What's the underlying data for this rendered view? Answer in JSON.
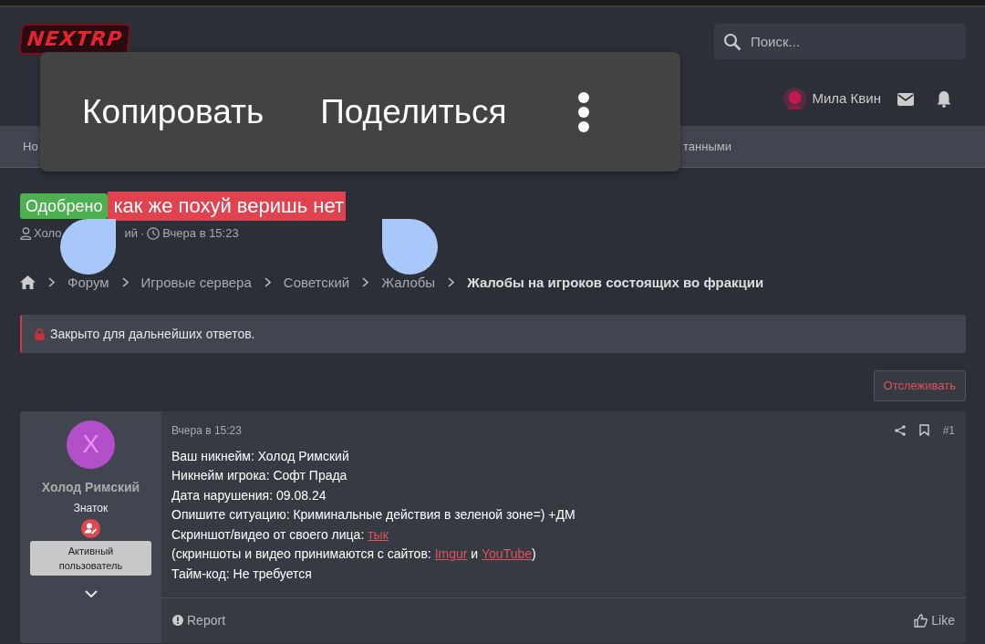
{
  "header": {
    "logo": "NEXTRP",
    "search": {
      "placeholder": "Поиск..."
    },
    "user": {
      "name": "Мила Квин"
    }
  },
  "nav": {
    "items": [
      {
        "label": "Но"
      },
      {
        "label": "танными"
      }
    ]
  },
  "selection_popup": {
    "actions": [
      "Копировать",
      "Поделиться"
    ]
  },
  "thread": {
    "prefix": "Одобрено",
    "title": "как же похуй веришь нет",
    "title_selected": true,
    "author_parts": [
      "Холо",
      "ий"
    ],
    "separator": "·",
    "date": "Вчера в 15:23"
  },
  "breadcrumbs": [
    {
      "label": "Форум",
      "current": false
    },
    {
      "label": "Игровые сервера",
      "current": false
    },
    {
      "label": "Советский",
      "current": false
    },
    {
      "label": "Жалобы",
      "current": false
    },
    {
      "label": "Жалобы на игроков состоящих во фракции",
      "current": true
    }
  ],
  "notice": "Закрыто для дальнейших ответов.",
  "watch_button": "Отслеживать",
  "post": {
    "avatar_letter": "Х",
    "author": "Холод Римский",
    "user_title": "Знаток",
    "banner": "Активный пользователь",
    "date": "Вчера в 15:23",
    "number": "#1",
    "lines": [
      [
        {
          "kind": "text",
          "text": "Ваш никнейм: Холод Римский"
        }
      ],
      [
        {
          "kind": "text",
          "text": "Никнейм игрока: Софт Прада"
        }
      ],
      [
        {
          "kind": "text",
          "text": "Дата нарушения: 09.08.24"
        }
      ],
      [
        {
          "kind": "text",
          "text": "Опишите ситуацию: Криминальные действия в зеленой зоне=) +ДМ"
        }
      ],
      [
        {
          "kind": "text",
          "text": "Скриншот/видео от своего лица: "
        },
        {
          "kind": "link",
          "text": "тык"
        }
      ],
      [
        {
          "kind": "text",
          "text": "(скриншоты и видео принимаются с сайтов: "
        },
        {
          "kind": "link",
          "text": "Imgur"
        },
        {
          "kind": "text",
          "text": " и "
        },
        {
          "kind": "link",
          "text": "YouTube"
        },
        {
          "kind": "text",
          "text": ")"
        }
      ],
      [
        {
          "kind": "text",
          "text": "Тайм-код: Не требуется"
        }
      ]
    ],
    "report": "Report",
    "like": "Like"
  }
}
